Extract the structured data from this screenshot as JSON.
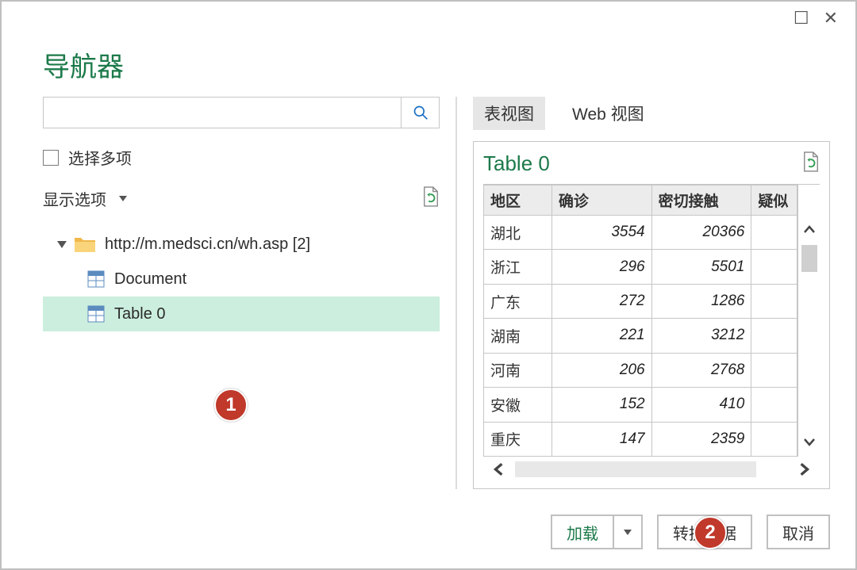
{
  "dialog": {
    "title": "导航器"
  },
  "left": {
    "multi_select": "选择多项",
    "display_options": "显示选项",
    "tree_root": "http://m.medsci.cn/wh.asp [2]",
    "tree_children": [
      "Document",
      "Table 0"
    ]
  },
  "tabs": {
    "table_view": "表视图",
    "web_view": "Web 视图"
  },
  "preview": {
    "title": "Table 0",
    "headers": [
      "地区",
      "确诊",
      "密切接触",
      "疑似"
    ],
    "rows": [
      {
        "region": "湖北",
        "confirmed": 3554,
        "contact": 20366
      },
      {
        "region": "浙江",
        "confirmed": 296,
        "contact": 5501
      },
      {
        "region": "广东",
        "confirmed": 272,
        "contact": 1286
      },
      {
        "region": "湖南",
        "confirmed": 221,
        "contact": 3212
      },
      {
        "region": "河南",
        "confirmed": 206,
        "contact": 2768
      },
      {
        "region": "安徽",
        "confirmed": 152,
        "contact": 410
      },
      {
        "region": "重庆",
        "confirmed": 147,
        "contact": 2359
      }
    ]
  },
  "buttons": {
    "load": "加载",
    "transform": "转换数据",
    "cancel": "取消"
  },
  "callouts": {
    "one": "1",
    "two": "2"
  }
}
